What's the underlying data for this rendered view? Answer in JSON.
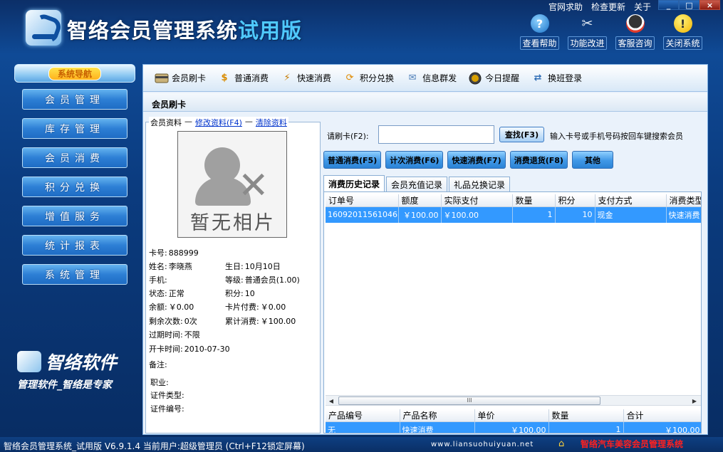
{
  "header": {
    "title": "智络会员管理系统",
    "title_suffix": "试用版",
    "top_links": [
      "官网求助",
      "检查更新",
      "关于"
    ],
    "window_buttons": [
      "_",
      "□",
      "×"
    ],
    "tool_buttons": [
      {
        "label": "查看帮助",
        "icon": "help-icon"
      },
      {
        "label": "功能改进",
        "icon": "tools-icon"
      },
      {
        "label": "客服咨询",
        "icon": "qq-icon"
      },
      {
        "label": "关闭系统",
        "icon": "warning-icon"
      }
    ]
  },
  "sidebar": {
    "header": "系统导航",
    "items": [
      "会员管理",
      "库存管理",
      "会员消费",
      "积分兑换",
      "增值服务",
      "统计报表",
      "系统管理"
    ],
    "brand_name": "智络软件",
    "brand_slogan": "管理软件_智络是专家"
  },
  "toolbar": {
    "items": [
      {
        "label": "会员刷卡",
        "icon": "card-icon"
      },
      {
        "label": "普通消费",
        "icon": "money-icon"
      },
      {
        "label": "快速消费",
        "icon": "fast-icon"
      },
      {
        "label": "积分兑换",
        "icon": "exchange-icon"
      },
      {
        "label": "信息群发",
        "icon": "mail-icon"
      },
      {
        "label": "今日提醒",
        "icon": "clock-icon"
      },
      {
        "label": "换班登录",
        "icon": "swap-icon"
      }
    ]
  },
  "panel": {
    "title": "会员刷卡"
  },
  "member": {
    "legend": "会员资料",
    "edit_link": "修改资料(F4)",
    "clear_link": "清除资料",
    "photo_text": "暂无相片",
    "fields": {
      "card_label": "卡号:",
      "card": "888999",
      "name_label": "姓名:",
      "name": "李晓燕",
      "birthday_label": "生日:",
      "birthday": "10月10日",
      "phone_label": "手机:",
      "phone": "",
      "level_label": "等级:",
      "level": "普通会员(1.00)",
      "status_label": "状态:",
      "status": "正常",
      "points_label": "积分:",
      "points": "10",
      "balance_label": "余额:",
      "balance": "￥0.00",
      "cardfee_label": "卡片付费:",
      "cardfee": "￥0.00",
      "remaining_label": "剩余次数:",
      "remaining": "0次",
      "total_label": "累计消费:",
      "total": "￥100.00",
      "expire_label": "过期时间:",
      "expire": "不限",
      "open_label": "开卡时间:",
      "open": "2010-07-30",
      "note_label": "备注:",
      "job_label": "职业:",
      "idtype_label": "证件类型:",
      "idno_label": "证件编号:"
    }
  },
  "search": {
    "label": "请刷卡(F2):",
    "value": "",
    "find_button": "查找(F3)",
    "hint": "输入卡号或手机号码按回车键搜索会员"
  },
  "actions": [
    "普通消费(F5)",
    "计次消费(F6)",
    "快速消费(F7)",
    "消费退货(F8)",
    "其他"
  ],
  "tabs": [
    "消费历史记录",
    "会员充值记录",
    "礼品兑换记录"
  ],
  "history_table": {
    "headers": [
      "订单号",
      "额度",
      "实际支付",
      "数量",
      "积分",
      "支付方式",
      "消费类型"
    ],
    "rows": [
      [
        "16092011561046",
        "￥100.00",
        "￥100.00",
        "1",
        "10",
        "现金",
        "快速消费"
      ]
    ]
  },
  "scrollbar": {
    "grip": "III"
  },
  "detail_table": {
    "headers": [
      "产品编号",
      "产品名称",
      "单价",
      "数量",
      "合计"
    ],
    "rows": [
      [
        "无",
        "快速消费",
        "￥100.00",
        "1",
        "￥100.00"
      ]
    ]
  },
  "statusbar": {
    "left": "智络会员管理系统_试用版 V6.9.1.4 当前用户:超级管理员 (Ctrl+F12锁定屏幕)",
    "url": "www.liansuohuiyuan.net",
    "right": "智络汽车美容会员管理系统"
  }
}
